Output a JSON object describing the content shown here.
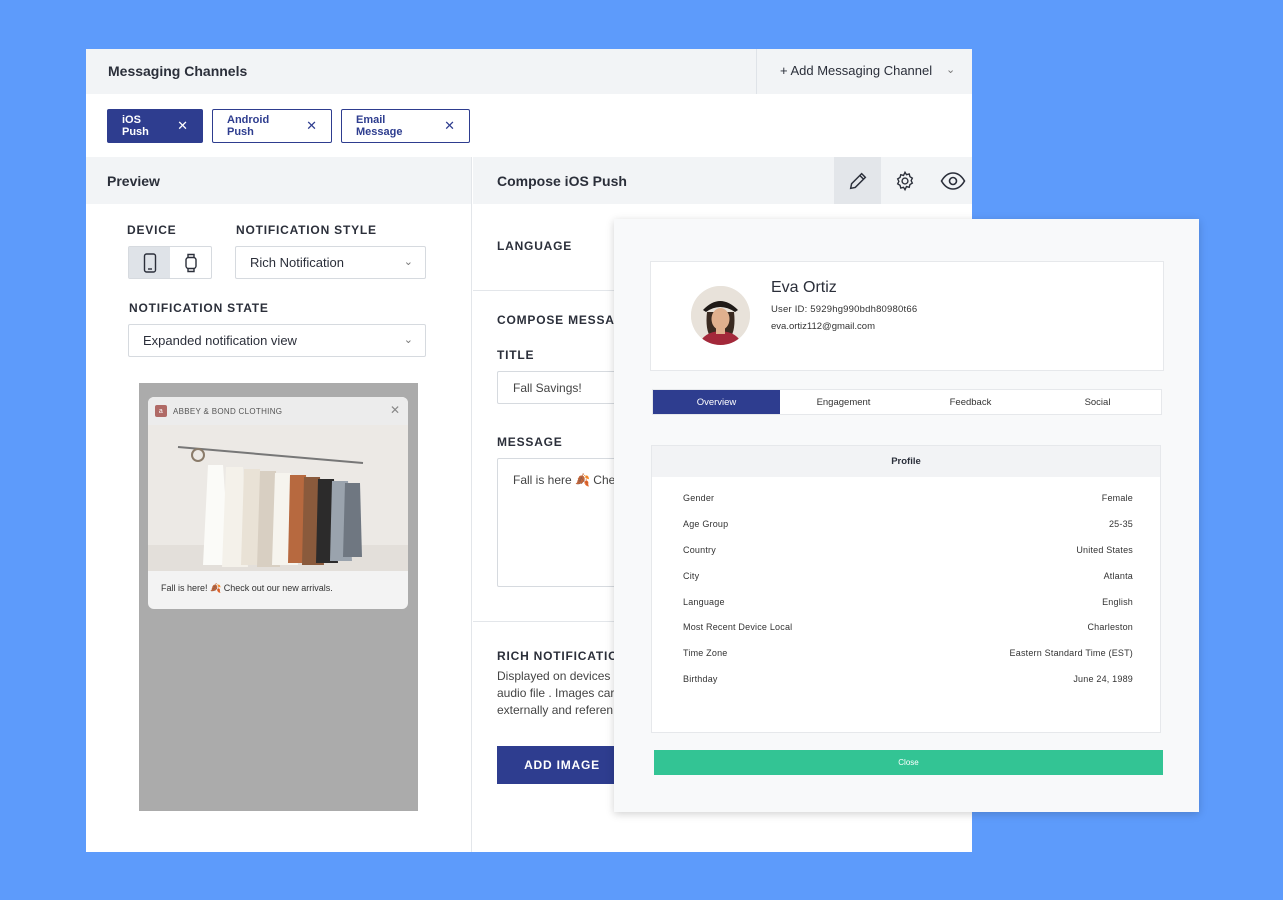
{
  "header": {
    "title": "Messaging Channels",
    "add_channel": "+ Add Messaging Channel"
  },
  "channels": [
    {
      "label": "iOS Push",
      "active": true
    },
    {
      "label": "Android Push",
      "active": false
    },
    {
      "label": "Email Message",
      "active": false
    }
  ],
  "preview": {
    "title": "Preview",
    "device_label": "DEVICE",
    "style_label": "NOTIFICATION STYLE",
    "style_value": "Rich Notification",
    "state_label": "NOTIFICATION STATE",
    "state_value": "Expanded notification view",
    "notification": {
      "logo_letter": "a",
      "brand": "ABBEY & BOND CLOTHING",
      "text": "Fall is here! 🍂 Check out our new arrivals."
    }
  },
  "compose": {
    "title": "Compose iOS Push",
    "language_label": "LANGUAGE",
    "compose_label": "COMPOSE MESSAG",
    "title_label": "TITLE",
    "title_value": "Fall Savings!",
    "message_label": "MESSAGE",
    "message_value": "Fall is here 🍂 Chec",
    "rich_label": "RICH NOTIFICATIO",
    "rich_desc_1": "Displayed on devices",
    "rich_desc_2": "audio file . Images car",
    "rich_desc_3": "externally and referen",
    "add_image": "ADD IMAGE"
  },
  "profile": {
    "name": "Eva Ortiz",
    "user_id": "User ID: 5929hg990bdh80980t66",
    "email": "eva.ortiz112@gmail.com",
    "tabs": [
      "Overview",
      "Engagement",
      "Feedback",
      "Social"
    ],
    "active_tab": "Overview",
    "section_title": "Profile",
    "rows": [
      {
        "key": "Gender",
        "value": "Female"
      },
      {
        "key": "Age Group",
        "value": "25-35"
      },
      {
        "key": "Country",
        "value": "United States"
      },
      {
        "key": "City",
        "value": "Atlanta"
      },
      {
        "key": "Language",
        "value": "English"
      },
      {
        "key": "Most Recent Device Local",
        "value": "Charleston"
      },
      {
        "key": "Time Zone",
        "value": "Eastern Standard Time (EST)"
      },
      {
        "key": "Birthday",
        "value": "June 24, 1989"
      }
    ],
    "close": "Close"
  },
  "colors": {
    "background": "#5d9bfb",
    "primary": "#2e3d8f",
    "success": "#33c494"
  }
}
